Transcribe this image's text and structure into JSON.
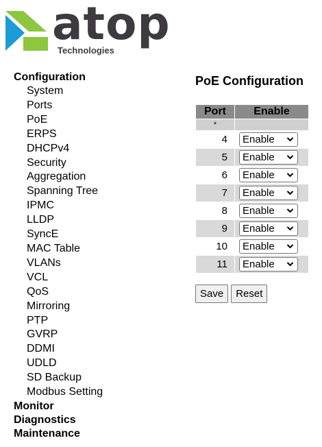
{
  "logo": {
    "wordmark": "atop",
    "tagline": "Technologies"
  },
  "nav": {
    "configuration": "Configuration",
    "items": [
      "System",
      "Ports",
      "PoE",
      "ERPS",
      "DHCPv4",
      "Security",
      "Aggregation",
      "Spanning Tree",
      "IPMC",
      "LLDP",
      "SyncE",
      "MAC Table",
      "VLANs",
      "VCL",
      "QoS",
      "Mirroring",
      "PTP",
      "GVRP",
      "DDMI",
      "UDLD",
      "SD Backup",
      "Modbus Setting"
    ],
    "monitor": "Monitor",
    "diagnostics": "Diagnostics",
    "maintenance": "Maintenance"
  },
  "page": {
    "title": "PoE Configuration"
  },
  "table": {
    "headers": {
      "port": "Port",
      "enable": "Enable"
    },
    "star": "*",
    "rows": [
      {
        "port": "4",
        "enable": "Enable"
      },
      {
        "port": "5",
        "enable": "Enable"
      },
      {
        "port": "6",
        "enable": "Enable"
      },
      {
        "port": "7",
        "enable": "Enable"
      },
      {
        "port": "8",
        "enable": "Enable"
      },
      {
        "port": "9",
        "enable": "Enable"
      },
      {
        "port": "10",
        "enable": "Enable"
      },
      {
        "port": "11",
        "enable": "Enable"
      }
    ]
  },
  "buttons": {
    "save": "Save",
    "reset": "Reset"
  },
  "colors": {
    "logo_green": "#8dc63f",
    "logo_blue": "#1b9bd7",
    "logo_text": "#3d3b40",
    "header_bg": "#8a8a8a"
  }
}
